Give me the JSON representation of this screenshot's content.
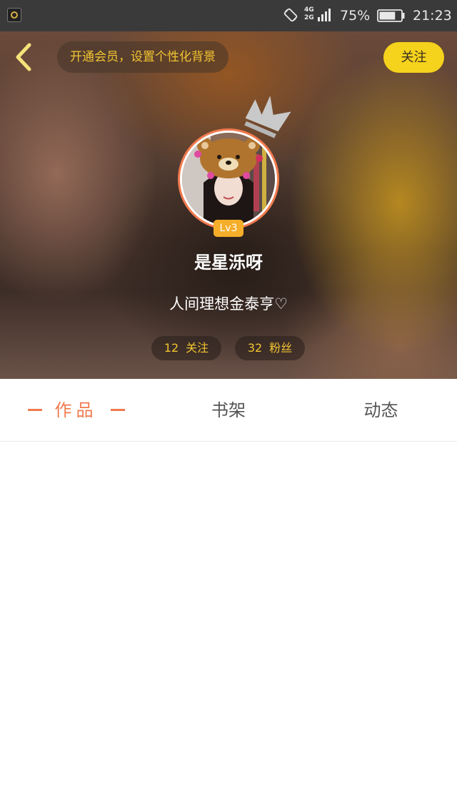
{
  "status_bar": {
    "network": [
      "4G",
      "2G"
    ],
    "battery_percent": "75%",
    "battery_level": 0.75,
    "time": "21:23"
  },
  "header": {
    "vip_banner": "开通会员，设置个性化背景",
    "follow_label": "关注",
    "level": "Lv3",
    "username": "是星泺呀",
    "bio": "人间理想金泰亨♡",
    "stats": {
      "following_count": "12",
      "following_label": "关注",
      "fans_count": "32",
      "fans_label": "粉丝"
    }
  },
  "tabs": [
    {
      "label": "作品",
      "active": true
    },
    {
      "label": "书架",
      "active": false
    },
    {
      "label": "动态",
      "active": false
    }
  ],
  "colors": {
    "accent": "#f07a4f",
    "highlight": "#f5d21c",
    "stat_text": "#f2c531",
    "level_badge": "#f4ae2a"
  },
  "icons": [
    "app-icon",
    "rotate-icon",
    "signal-icon",
    "battery-icon",
    "back-arrow-icon",
    "crown-icon"
  ]
}
